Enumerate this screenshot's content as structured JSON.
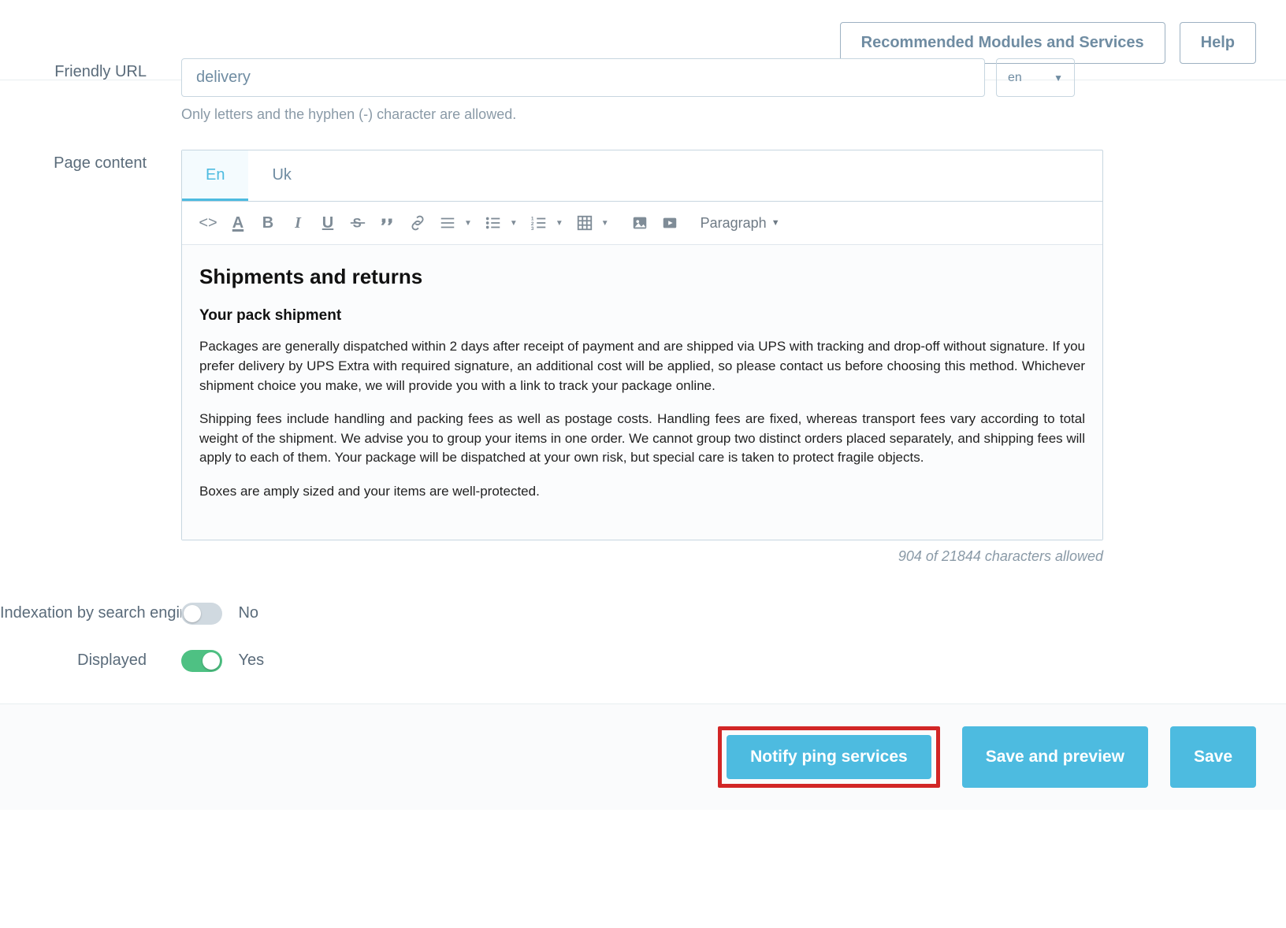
{
  "header": {
    "recommended_label": "Recommended Modules and Services",
    "help_label": "Help"
  },
  "friendly_url": {
    "label": "Friendly URL",
    "value": "delivery",
    "lang": "en",
    "help": "Only letters and the hyphen (-) character are allowed."
  },
  "page_content": {
    "label": "Page content",
    "tabs": [
      "En",
      "Uk"
    ],
    "active_tab": "En",
    "toolbar": {
      "paragraph_label": "Paragraph"
    },
    "body": {
      "h2": "Shipments and returns",
      "h3": "Your pack shipment",
      "p1": "Packages are generally dispatched within 2 days after receipt of payment and are shipped via UPS with tracking and drop-off without signature. If you prefer delivery by UPS Extra with required signature, an additional cost will be applied, so please contact us before choosing this method. Whichever shipment choice you make, we will provide you with a link to track your package online.",
      "p2": "Shipping fees include handling and packing fees as well as postage costs. Handling fees are fixed, whereas transport fees vary according to total weight of the shipment. We advise you to group your items in one order. We cannot group two distinct orders placed separately, and shipping fees will apply to each of them. Your package will be dispatched at your own risk, but special care is taken to protect fragile objects.",
      "p3": "Boxes are amply sized and your items are well-protected."
    },
    "char_count": "904 of 21844 characters allowed"
  },
  "indexation": {
    "label": "Indexation by search engines",
    "value_label": "No"
  },
  "displayed": {
    "label": "Displayed",
    "value_label": "Yes"
  },
  "footer": {
    "notify": "Notify ping services",
    "save_preview": "Save and preview",
    "save": "Save"
  }
}
